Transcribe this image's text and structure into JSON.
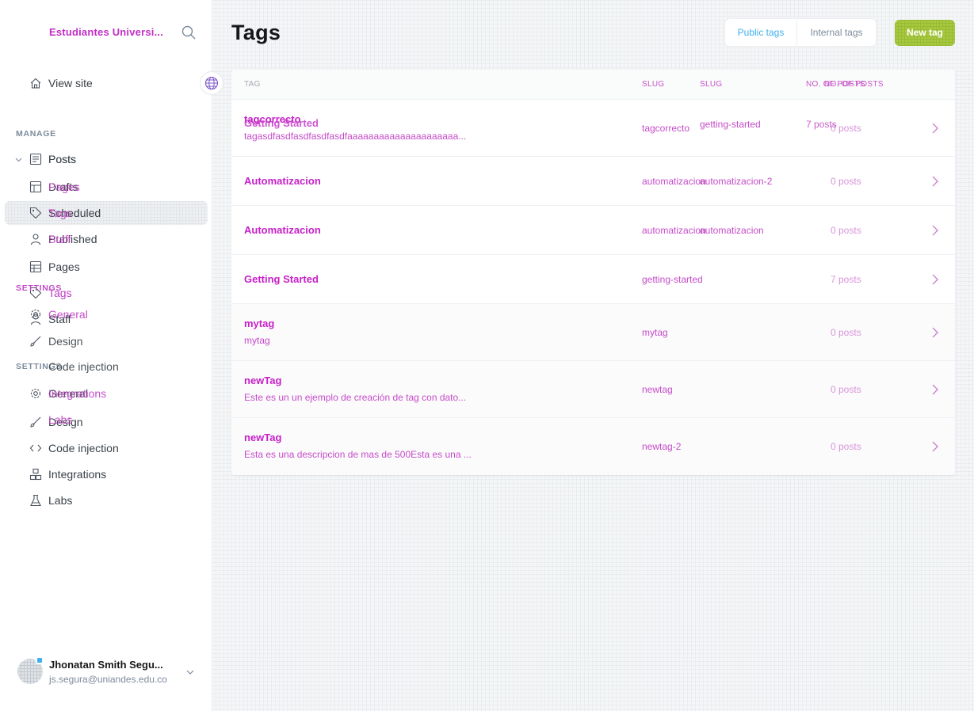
{
  "sidebar": {
    "site_title": "Estudiantes Universi...",
    "view_site": "View site",
    "manage_heading": "MANAGE",
    "settings_heading": "SETTINGS",
    "layer_a": {
      "posts": "Posts",
      "pages": "Pages",
      "tags": "Tags",
      "staff": "Staff",
      "general": "General",
      "design": "Design",
      "code_injection": "Code injection",
      "integrations": "Integrations",
      "labs": "Labs"
    },
    "layer_b": {
      "posts": "Posts",
      "drafts": "Drafts",
      "scheduled": "Scheduled",
      "published": "Published",
      "pages": "Pages",
      "tags": "Tags",
      "staff": "Staff",
      "general": "General",
      "design": "Design",
      "code_injection": "Code injection",
      "integrations": "Integrations",
      "labs": "Labs"
    },
    "selected_item": "Tags",
    "user": {
      "name": "Jhonatan Smith Segu...",
      "email": "js.segura@uniandes.edu.co"
    }
  },
  "header": {
    "title": "Tags",
    "tab_public": "Public tags",
    "tab_internal": "Internal tags",
    "active_tab": "Public tags",
    "new_tag": "New tag"
  },
  "table": {
    "columns": {
      "tag": "TAG",
      "slug": "SLUG",
      "slug_overlay": "SLUG",
      "posts": "NO. OF POSTS",
      "posts_overlay": "NO. OF POSTS"
    },
    "rows": [
      {
        "name": "tagcorrecto",
        "name_overlay": "Getting Started",
        "description": "tagasdfasdfasdfasdfasdfaaaaaaaaaaaaaaaaaaaaa...",
        "slug": "tagcorrecto",
        "slug_overlay": "getting-started",
        "posts": "0 posts",
        "posts_overlay": "7 posts"
      },
      {
        "name": "Automatizacion",
        "slug": "automatizacion",
        "slug_overlay": "automatizacion-2",
        "posts": "0 posts"
      },
      {
        "name": "Automatizacion",
        "slug": "automatizacion",
        "slug_overlay": "automatizacion",
        "posts": "0 posts"
      },
      {
        "name": "Getting Started",
        "slug": "getting-started",
        "posts": "7 posts"
      },
      {
        "name": "mytag",
        "description": "mytag",
        "slug": "mytag",
        "posts": "0 posts"
      },
      {
        "name": "newTag",
        "description": "Este es un un ejemplo de creación de tag con dato...",
        "slug": "newtag",
        "posts": "0 posts"
      },
      {
        "name": "newTag",
        "description": "Esta es una descripcion de mas de 500Esta es una ...",
        "slug": "newtag-2",
        "posts": "0 posts"
      }
    ]
  },
  "colors": {
    "accent_blue": "#3eb0ef",
    "new_tag_green": "#a7c93f",
    "glitch_magenta": "#c620c8",
    "text_dark": "#15171a",
    "text_muted": "#7c8b9a"
  },
  "icons": [
    "search-icon",
    "home-icon",
    "globe-icon",
    "posts-icon",
    "pages-icon",
    "tag-icon",
    "staff-icon",
    "gear-icon",
    "design-icon",
    "code-icon",
    "integrations-icon",
    "labs-icon",
    "chevron-down-icon",
    "chevron-right-icon"
  ]
}
